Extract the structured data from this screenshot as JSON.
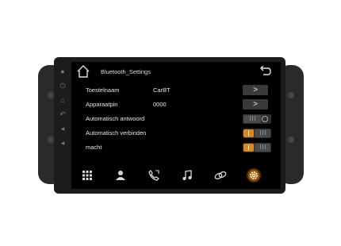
{
  "header": {
    "title": "Bluetooth_Settings"
  },
  "settings": [
    {
      "label": "Toestelnaam",
      "value": "CarBT",
      "control": "arrow"
    },
    {
      "label": "Apparaatpin",
      "value": "0000",
      "control": "arrow"
    },
    {
      "label": "Automatisch antwoord",
      "value": "",
      "control": "toggle",
      "state": "off"
    },
    {
      "label": "Automatisch verbinden",
      "value": "",
      "control": "toggle",
      "state": "on"
    },
    {
      "label": "macht",
      "value": "",
      "control": "toggle",
      "state": "on"
    }
  ],
  "arrow_glyph": ">",
  "bottom_nav": [
    "apps-grid-icon",
    "contacts-icon",
    "phone-icon",
    "music-icon",
    "link-icon",
    "settings-gear-icon"
  ],
  "bottom_nav_active": "settings-gear-icon",
  "side_buttons": [
    "mic-icon",
    "power-icon",
    "home-icon",
    "back-icon",
    "volume-up-icon",
    "volume-down-icon"
  ],
  "accent_color": "#d98a1e"
}
